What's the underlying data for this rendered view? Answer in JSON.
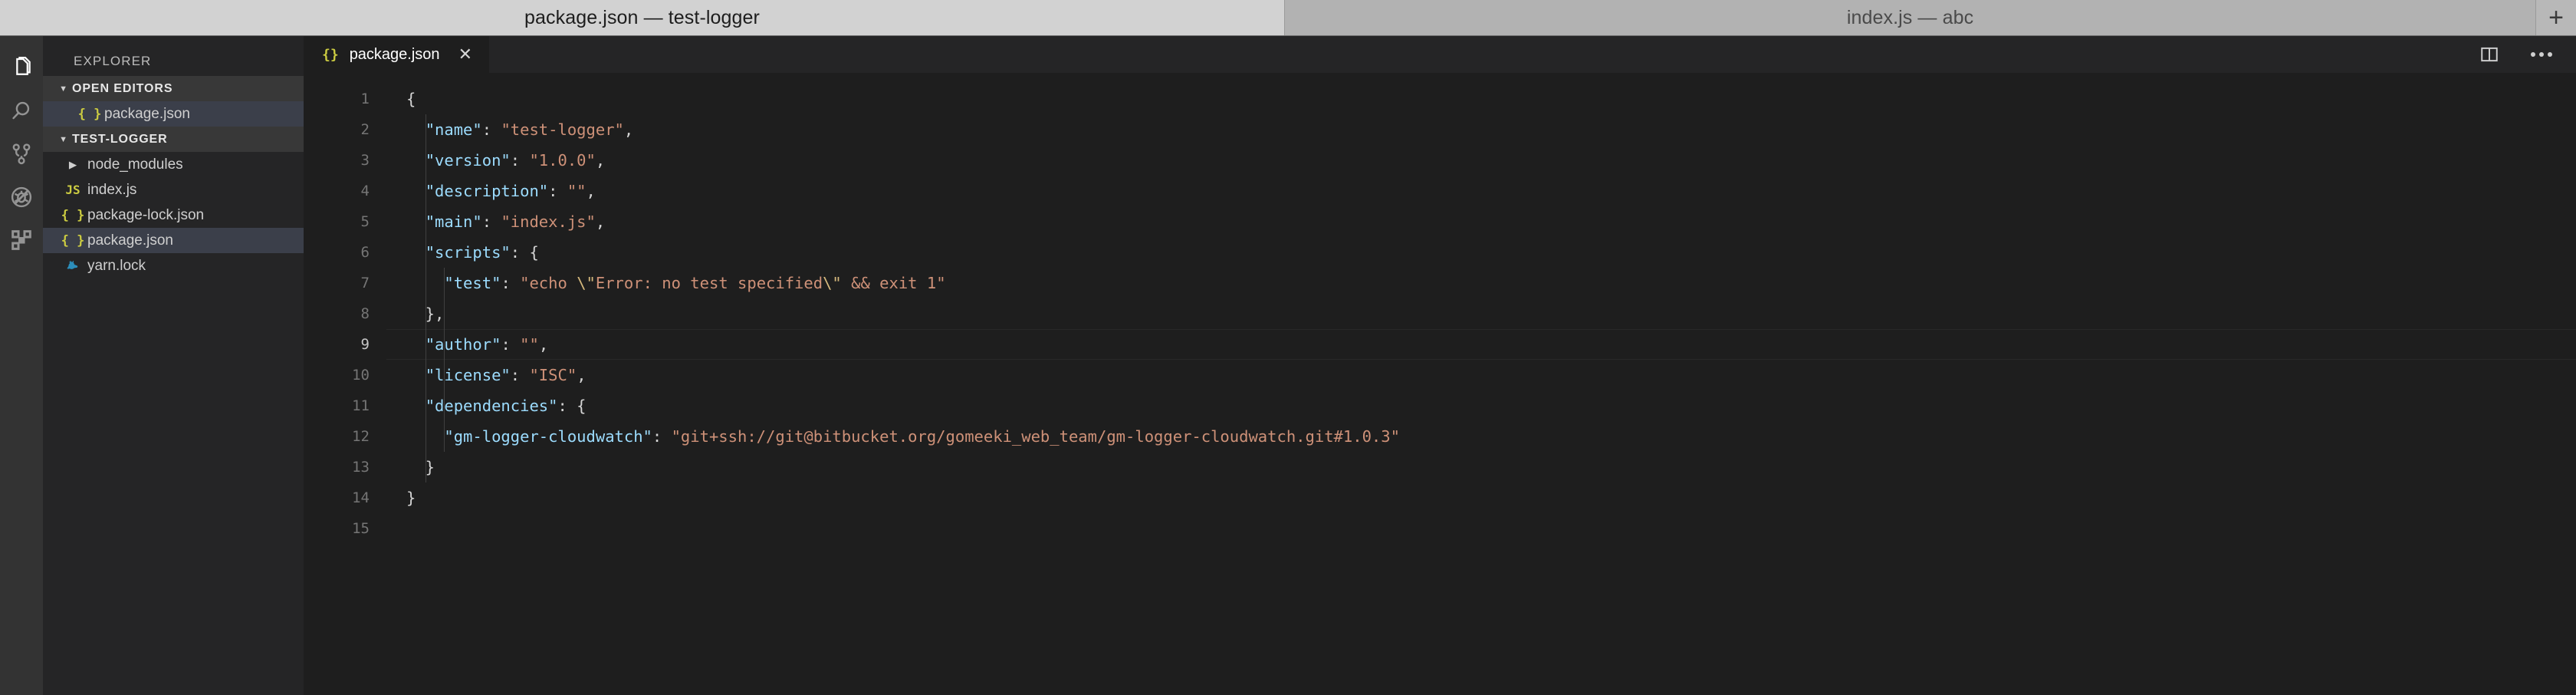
{
  "window": {
    "tabs": [
      {
        "title": "package.json — test-logger",
        "active": true
      },
      {
        "title": "index.js — abc",
        "active": false
      }
    ],
    "new_tab_label": "+"
  },
  "activitybar": {
    "items": [
      {
        "name": "explorer-icon",
        "label": "Explorer",
        "active": true
      },
      {
        "name": "search-icon",
        "label": "Search",
        "active": false
      },
      {
        "name": "source-control-icon",
        "label": "Source Control",
        "active": false
      },
      {
        "name": "debug-icon",
        "label": "Run and Debug",
        "active": false
      },
      {
        "name": "extensions-icon",
        "label": "Extensions",
        "active": false
      }
    ]
  },
  "sidebar": {
    "title": "EXPLORER",
    "open_editors": {
      "header": "OPEN EDITORS",
      "expanded": true,
      "items": [
        {
          "icon": "json-icon",
          "label": "package.json",
          "selected": true
        }
      ]
    },
    "workspace": {
      "header": "TEST-LOGGER",
      "expanded": true,
      "items": [
        {
          "icon": "folder-icon",
          "label": "node_modules",
          "type": "folder",
          "expanded": false,
          "selected": false
        },
        {
          "icon": "js-icon",
          "label": "index.js",
          "type": "file",
          "selected": false
        },
        {
          "icon": "json-icon",
          "label": "package-lock.json",
          "type": "file",
          "selected": false
        },
        {
          "icon": "json-icon",
          "label": "package.json",
          "type": "file",
          "selected": true
        },
        {
          "icon": "yarn-icon",
          "label": "yarn.lock",
          "type": "file",
          "selected": false
        }
      ]
    }
  },
  "editor": {
    "tab": {
      "icon": "{}",
      "label": "package.json",
      "close": "✕",
      "active": true
    },
    "actions": [
      {
        "name": "split-editor-icon",
        "label": "Split Editor"
      },
      {
        "name": "more-actions-icon",
        "label": "More Actions..."
      }
    ],
    "language": "json",
    "current_line": 9,
    "line_numbers": [
      "1",
      "2",
      "3",
      "4",
      "5",
      "6",
      "7",
      "8",
      "9",
      "10",
      "11",
      "12",
      "13",
      "14",
      "15"
    ],
    "lines": [
      {
        "n": 1,
        "text": "{"
      },
      {
        "n": 2,
        "text": "  \"name\": \"test-logger\","
      },
      {
        "n": 3,
        "text": "  \"version\": \"1.0.0\","
      },
      {
        "n": 4,
        "text": "  \"description\": \"\","
      },
      {
        "n": 5,
        "text": "  \"main\": \"index.js\","
      },
      {
        "n": 6,
        "text": "  \"scripts\": {"
      },
      {
        "n": 7,
        "text": "    \"test\": \"echo \\\"Error: no test specified\\\" && exit 1\""
      },
      {
        "n": 8,
        "text": "  },"
      },
      {
        "n": 9,
        "text": "  \"author\": \"\","
      },
      {
        "n": 10,
        "text": "  \"license\": \"ISC\","
      },
      {
        "n": 11,
        "text": "  \"dependencies\": {"
      },
      {
        "n": 12,
        "text": "    \"gm-logger-cloudwatch\": \"git+ssh://git@bitbucket.org/gomeeki_web_team/gm-logger-cloudwatch.git#1.0.3\""
      },
      {
        "n": 13,
        "text": "  }"
      },
      {
        "n": 14,
        "text": "}"
      },
      {
        "n": 15,
        "text": ""
      }
    ]
  },
  "colors": {
    "editor_bg": "#1e1e1e",
    "sidebar_bg": "#252526",
    "activitybar_bg": "#333333",
    "section_header_bg": "#383838",
    "selection_bg": "#3b3f4a",
    "key": "#9cdcfe",
    "string": "#ce9178",
    "escape": "#d7ba7d",
    "punctuation": "#d4d4d4",
    "json_icon": "#cbcb41",
    "yarn_icon": "#2c8ebb",
    "titlebar_active": "#d2d2d2",
    "titlebar_inactive": "#b2b2b2"
  }
}
